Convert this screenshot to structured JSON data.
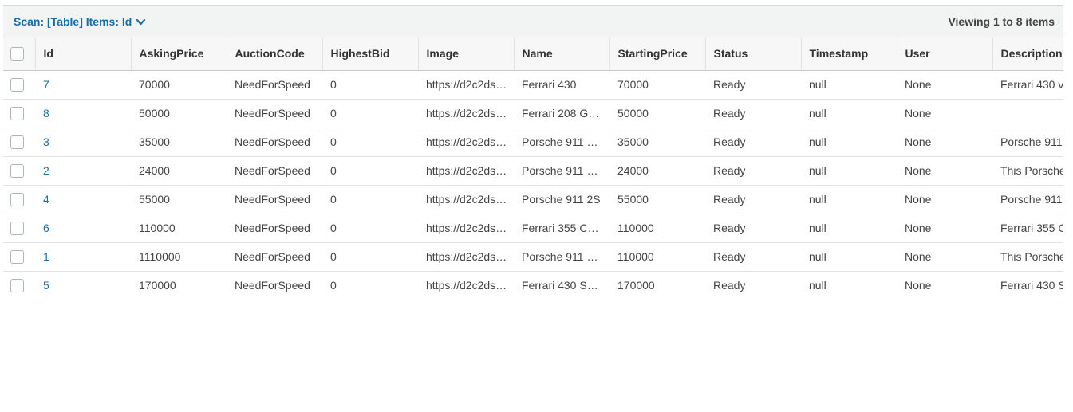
{
  "toolbar": {
    "scan_label": "Scan: [Table] Items: Id",
    "viewing": "Viewing 1 to 8 items"
  },
  "icons": {
    "expand": "chevron-down-icon",
    "select": "checkbox-icon"
  },
  "colors": {
    "link": "#1a6ea8",
    "header_bg": "#f7f7f7",
    "toolbar_bg": "#f2f3f3"
  },
  "columns": [
    "Id",
    "AskingPrice",
    "AuctionCode",
    "HighestBid",
    "Image",
    "Name",
    "StartingPrice",
    "Status",
    "Timestamp",
    "User",
    "Description"
  ],
  "rows": [
    {
      "id": "7",
      "asking": "70000",
      "auction": "NeedForSpeed",
      "bid": "0",
      "image": "https://d2c2ds…",
      "name": "Ferrari 430",
      "starting": "70000",
      "status": "Ready",
      "timestamp": "null",
      "user": "None",
      "description": "Ferrari 430 v"
    },
    {
      "id": "8",
      "asking": "50000",
      "auction": "NeedForSpeed",
      "bid": "0",
      "image": "https://d2c2ds…",
      "name": "Ferrari 208 G…",
      "starting": "50000",
      "status": "Ready",
      "timestamp": "null",
      "user": "None",
      "description": ""
    },
    {
      "id": "3",
      "asking": "35000",
      "auction": "NeedForSpeed",
      "bid": "0",
      "image": "https://d2c2ds…",
      "name": "Porsche 911 …",
      "starting": "35000",
      "status": "Ready",
      "timestamp": "null",
      "user": "None",
      "description": "Porsche 911"
    },
    {
      "id": "2",
      "asking": "24000",
      "auction": "NeedForSpeed",
      "bid": "0",
      "image": "https://d2c2ds…",
      "name": "Porsche 911 …",
      "starting": "24000",
      "status": "Ready",
      "timestamp": "null",
      "user": "None",
      "description": "This Porsche"
    },
    {
      "id": "4",
      "asking": "55000",
      "auction": "NeedForSpeed",
      "bid": "0",
      "image": "https://d2c2ds…",
      "name": "Porsche 911 2S",
      "starting": "55000",
      "status": "Ready",
      "timestamp": "null",
      "user": "None",
      "description": "Porsche 911"
    },
    {
      "id": "6",
      "asking": "110000",
      "auction": "NeedForSpeed",
      "bid": "0",
      "image": "https://d2c2ds…",
      "name": "Ferrari 355 C…",
      "starting": "110000",
      "status": "Ready",
      "timestamp": "null",
      "user": "None",
      "description": "Ferrari 355 C"
    },
    {
      "id": "1",
      "asking": "1110000",
      "auction": "NeedForSpeed",
      "bid": "0",
      "image": "https://d2c2ds…",
      "name": "Porsche 911 …",
      "starting": "110000",
      "status": "Ready",
      "timestamp": "null",
      "user": "None",
      "description": "This Porsche"
    },
    {
      "id": "5",
      "asking": "170000",
      "auction": "NeedForSpeed",
      "bid": "0",
      "image": "https://d2c2ds…",
      "name": "Ferrari 430 S…",
      "starting": "170000",
      "status": "Ready",
      "timestamp": "null",
      "user": "None",
      "description": "Ferrari 430 S"
    }
  ]
}
